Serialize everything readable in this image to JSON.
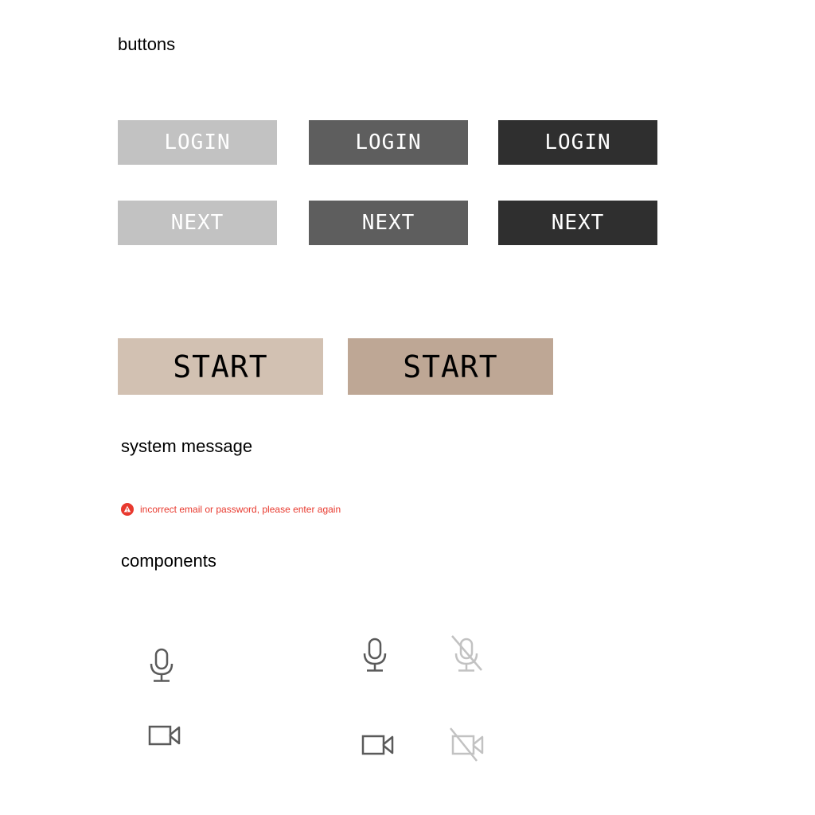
{
  "headings": {
    "buttons": "buttons",
    "system_message": "system message",
    "components": "components"
  },
  "login_buttons": [
    {
      "label": "LOGIN",
      "bg": "#c2c2c2"
    },
    {
      "label": "LOGIN",
      "bg": "#5e5e5e"
    },
    {
      "label": "LOGIN",
      "bg": "#2f2f2f"
    }
  ],
  "next_buttons": [
    {
      "label": "NEXT",
      "bg": "#c2c2c2"
    },
    {
      "label": "NEXT",
      "bg": "#5e5e5e"
    },
    {
      "label": "NEXT",
      "bg": "#2f2f2f"
    }
  ],
  "start_buttons": [
    {
      "label": "START",
      "bg": "#d2c1b2"
    },
    {
      "label": "START",
      "bg": "#bea795"
    }
  ],
  "system_message": {
    "text": "incorrect email or password, please enter again",
    "color": "#e8392e",
    "icon": "warning-icon"
  },
  "components": {
    "icons": [
      "microphone-icon",
      "video-camera-icon",
      "microphone-icon",
      "microphone-muted-icon",
      "video-camera-icon",
      "video-camera-off-icon"
    ],
    "icon_color": "#5a5a5a",
    "disabled_icon_color": "#c2c2c2"
  }
}
